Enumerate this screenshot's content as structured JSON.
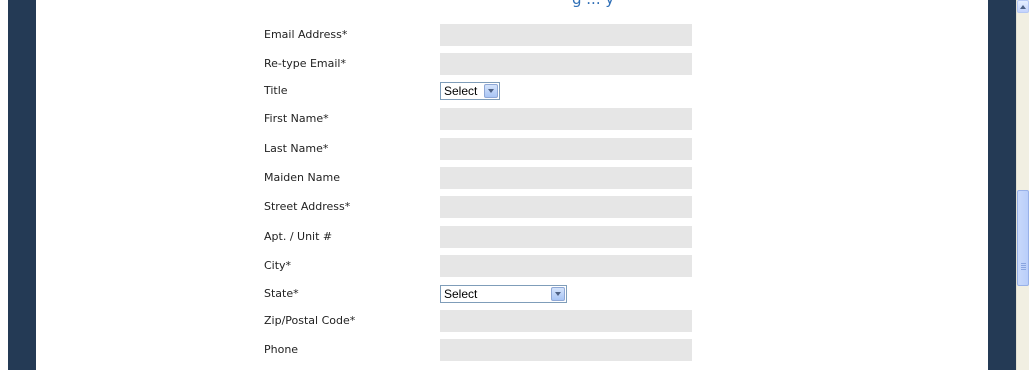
{
  "page": {
    "header_partial": "g ... y"
  },
  "form": {
    "fields": [
      {
        "label": "Email Address*",
        "type": "text",
        "value": ""
      },
      {
        "label": "Re-type Email*",
        "type": "text",
        "value": ""
      },
      {
        "label": "Title",
        "type": "select",
        "value": "Select"
      },
      {
        "label": "First Name*",
        "type": "text",
        "value": ""
      },
      {
        "label": "Last Name*",
        "type": "text",
        "value": ""
      },
      {
        "label": "Maiden Name",
        "type": "text",
        "value": ""
      },
      {
        "label": "Street Address*",
        "type": "text",
        "value": ""
      },
      {
        "label": "Apt. / Unit #",
        "type": "text",
        "value": ""
      },
      {
        "label": "City*",
        "type": "text",
        "value": ""
      },
      {
        "label": "State*",
        "type": "select",
        "value": "Select"
      },
      {
        "label": "Zip/Postal Code*",
        "type": "text",
        "value": ""
      },
      {
        "label": "Phone",
        "type": "text",
        "value": ""
      }
    ]
  },
  "colors": {
    "side_panel": "#243a55",
    "input_bg": "#e6e6e6",
    "header_text": "#2f6fb6"
  }
}
